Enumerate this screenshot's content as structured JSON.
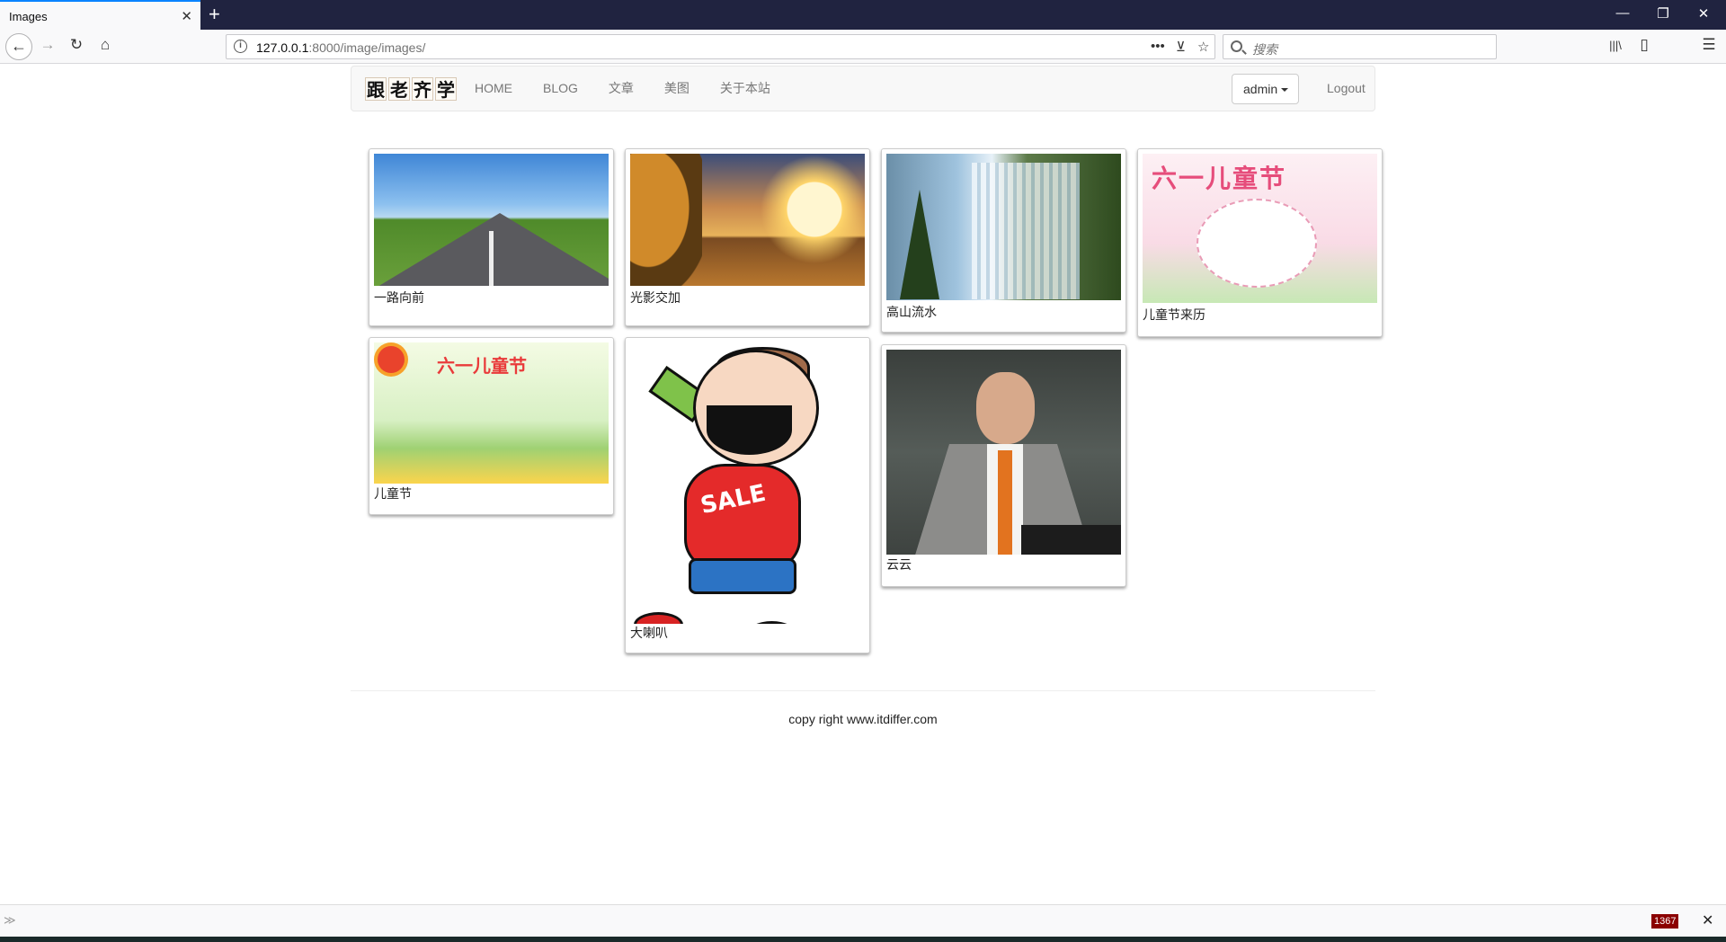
{
  "browser": {
    "tab_title": "Images",
    "tab_close": "✕",
    "new_tab": "+",
    "url_host": "127.0.0.1",
    "url_rest": ":8000/image/images/",
    "url_info": "i",
    "page_actions": "•••",
    "search_placeholder": "搜索",
    "window_minimize": "—",
    "window_restore": "❐",
    "window_close": "✕",
    "back": "←",
    "forward": "→",
    "reload": "↻",
    "home": "⌂",
    "library": "|||\\",
    "sidebar": "▯",
    "menu": "☰",
    "pocket": "⊻",
    "bookmark": "☆"
  },
  "site": {
    "brand_chars": [
      "跟",
      "老",
      "齐",
      "学"
    ],
    "nav": [
      "HOME",
      "BLOG",
      "文章",
      "美图",
      "关于本站"
    ],
    "user_button": "admin",
    "logout": "Logout"
  },
  "images": [
    {
      "title": "一路向前",
      "picture": "road"
    },
    {
      "title": "光影交加",
      "picture": "sunset"
    },
    {
      "title": "高山流水",
      "picture": "waterfall"
    },
    {
      "title": "儿童节来历",
      "picture": "childrens-day-poster"
    },
    {
      "title": "儿童节",
      "picture": "childrens-day-cartoon"
    },
    {
      "title": "大喇叭",
      "picture": "sale-cartoon"
    },
    {
      "title": "云云",
      "picture": "man-speaking"
    }
  ],
  "footer": {
    "text": "copy right www.itdiffer.com"
  },
  "bottombar": {
    "toggle": "≫",
    "badge": "1367",
    "close": "✕"
  }
}
